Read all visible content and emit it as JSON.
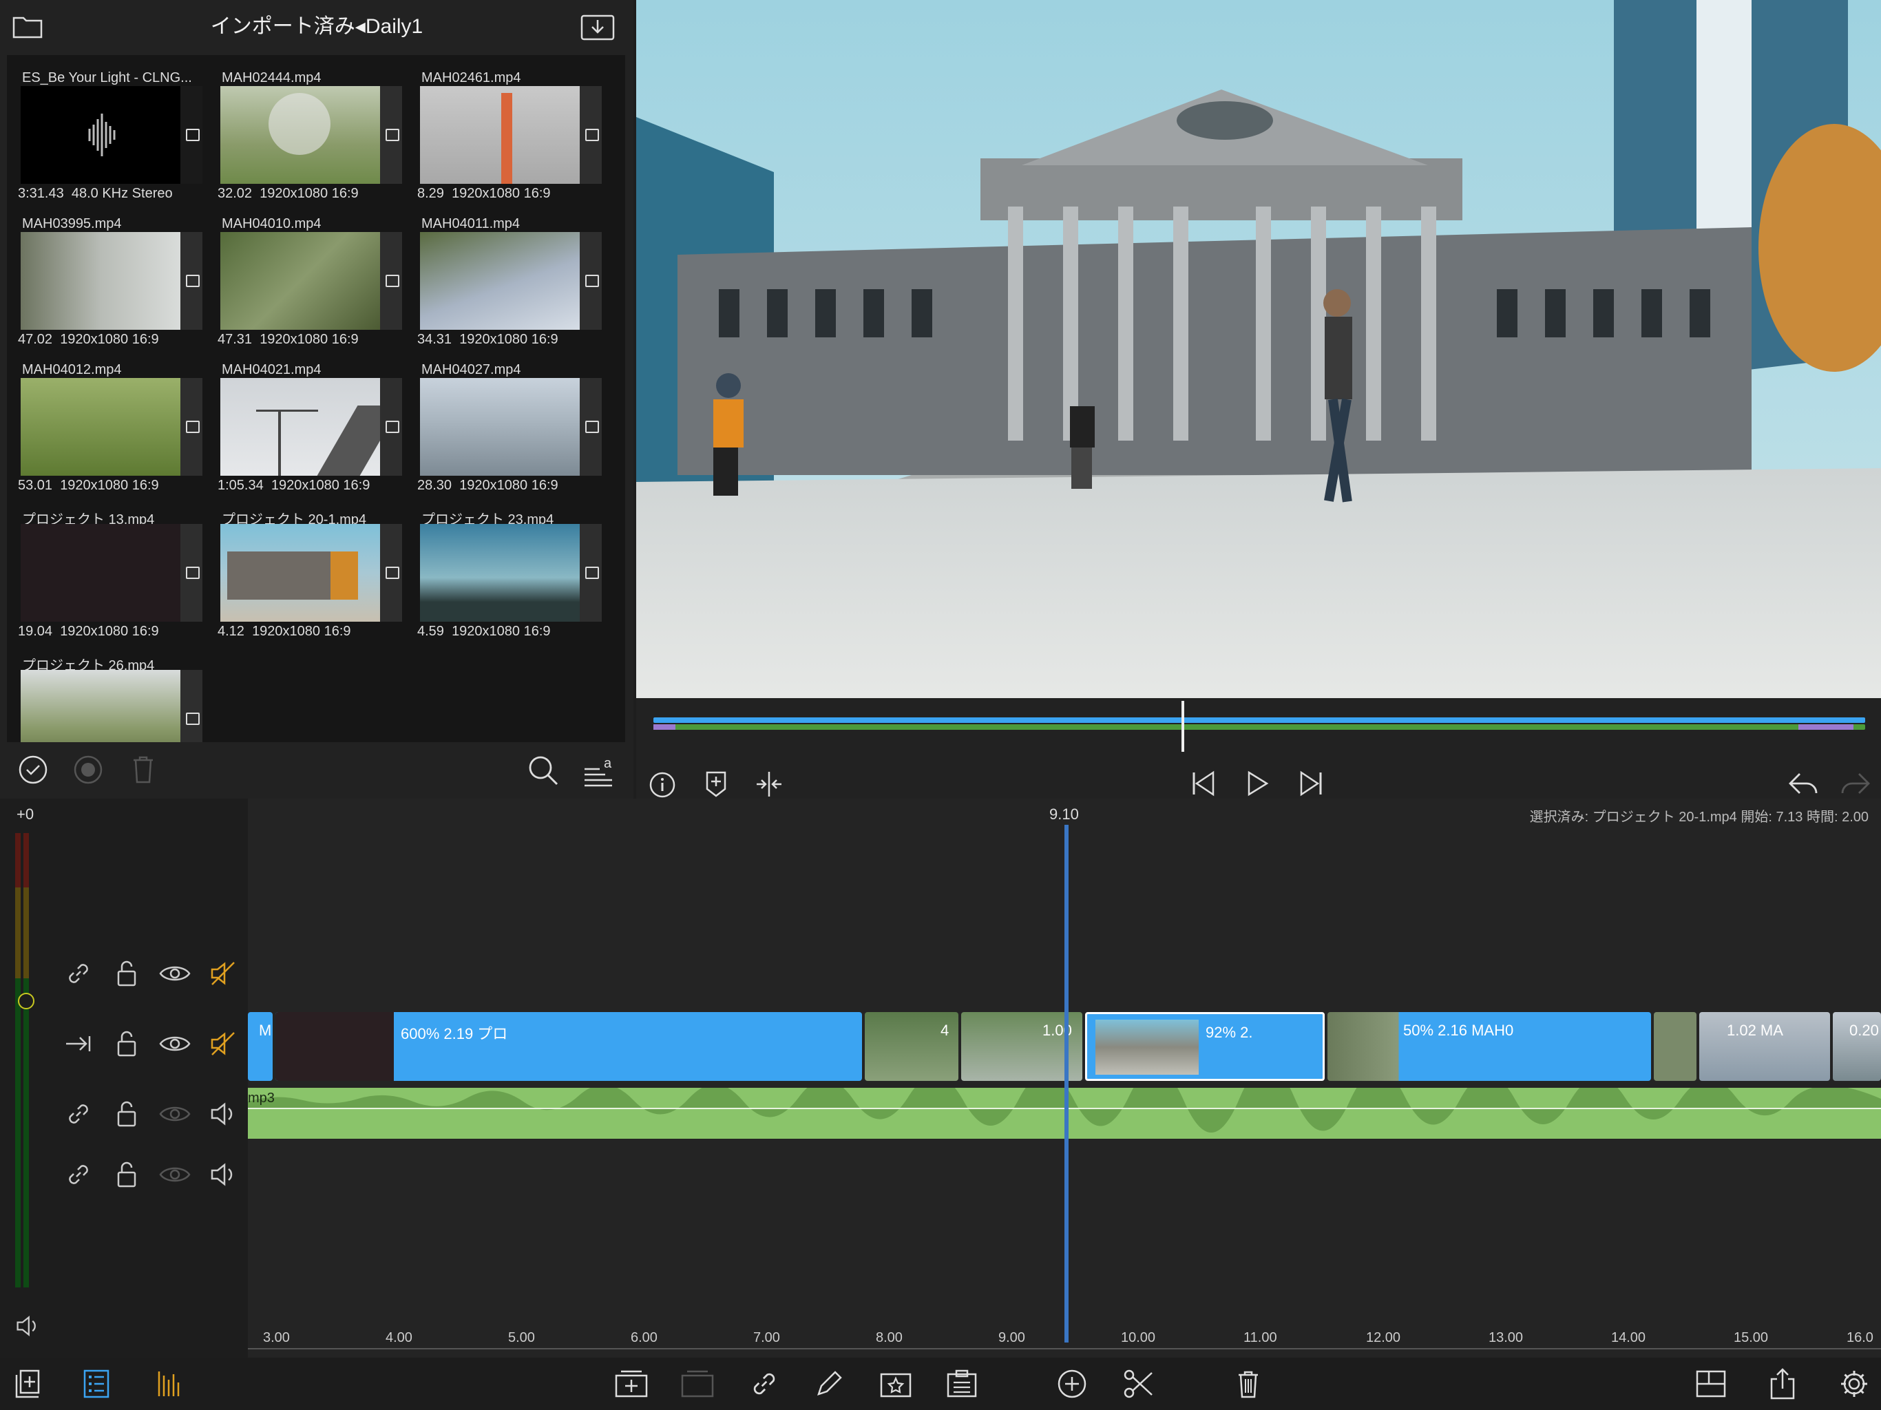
{
  "library": {
    "title": "インポート済み◂Daily1",
    "clips": [
      {
        "name": "ES_Be Your Light - CLNG...",
        "duration": "3:31.43",
        "info": "48.0 KHz  Stereo",
        "type": "audio"
      },
      {
        "name": "MAH02444.mp4",
        "duration": "32.02",
        "info": "1920x1080  16:9",
        "type": "video"
      },
      {
        "name": "MAH02461.mp4",
        "duration": "8.29",
        "info": "1920x1080  16:9",
        "type": "video"
      },
      {
        "name": "MAH03995.mp4",
        "duration": "47.02",
        "info": "1920x1080  16:9",
        "type": "video"
      },
      {
        "name": "MAH04010.mp4",
        "duration": "47.31",
        "info": "1920x1080  16:9",
        "type": "video"
      },
      {
        "name": "MAH04011.mp4",
        "duration": "34.31",
        "info": "1920x1080  16:9",
        "type": "video"
      },
      {
        "name": "MAH04012.mp4",
        "duration": "53.01",
        "info": "1920x1080  16:9",
        "type": "video"
      },
      {
        "name": "MAH04021.mp4",
        "duration": "1:05.34",
        "info": "1920x1080  16:9",
        "type": "video"
      },
      {
        "name": "MAH04027.mp4",
        "duration": "28.30",
        "info": "1920x1080  16:9",
        "type": "video"
      },
      {
        "name": "プロジェクト 13.mp4",
        "duration": "19.04",
        "info": "1920x1080  16:9",
        "type": "project"
      },
      {
        "name": "プロジェクト 20-1.mp4",
        "duration": "4.12",
        "info": "1920x1080  16:9",
        "type": "project"
      },
      {
        "name": "プロジェクト 23.mp4",
        "duration": "4.59",
        "info": "1920x1080  16:9",
        "type": "project"
      },
      {
        "name": "プロジェクト 26.mp4",
        "duration": "",
        "info": "",
        "type": "project"
      }
    ]
  },
  "timeline": {
    "meter_label": "+0",
    "playhead_time": "9.10",
    "selection_info": "選択済み: プロジェクト 20-1.mp4 開始: 7.13 時間: 2.00",
    "ticks": [
      "3.00",
      "4.00",
      "5.00",
      "6.00",
      "7.00",
      "8.00",
      "9.00",
      "10.00",
      "11.00",
      "12.00",
      "13.00",
      "14.00",
      "15.00",
      "16.0"
    ],
    "audio_track_label": "mp3",
    "segment_labels": {
      "seg_a": "M",
      "seg_b": "600%   2.19    プロ",
      "seg_c": "4",
      "seg_d": "1.00",
      "seg_e": "92%   2.",
      "seg_f": "50%   2.16    MAH0",
      "seg_g": "1.02    MA",
      "seg_h": "0.20"
    }
  },
  "colors": {
    "accent_blue": "#3ba4f2",
    "audio_green": "#8ac46a",
    "mute_orange": "#e0a020",
    "playhead": "#3a76c4"
  }
}
